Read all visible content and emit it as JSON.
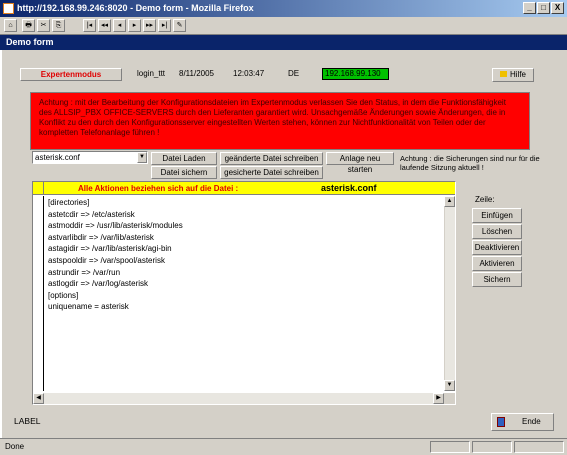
{
  "window": {
    "title": "http://192.168.99.246:8020 - Demo form - Mozilla Firefox",
    "minimize": "_",
    "maximize": "□",
    "close": "X"
  },
  "toolbar": {
    "buttons": [
      "⌂",
      "🖶",
      "✂",
      "⎘",
      "|◂",
      "◂◂",
      "◂",
      "▸",
      "▸▸",
      "▸|",
      "✎"
    ]
  },
  "form": {
    "title": "Demo form"
  },
  "header": {
    "mode_label": "Expertenmodus",
    "user": "login_ttt",
    "date": "8/11/2005",
    "time": "12:03:47",
    "lang": "DE",
    "ip": "192.168.99.130",
    "help_label": "Hilfe"
  },
  "warning": "Achtung : mit der Bearbeitung der Konfigurationsdateien im Expertenmodus verlassen Sie den Status, in dem die Funktionsfähigkeit des ALLSIP_PBX OFFICE-SERVERS durch den Lieferanten garantiert wird. Unsachgemäße Änderungen sowie Änderungen, die in Konflikt zu den durch den Konfigurationsserver eingestellten Werten stehen, können zur Nichtfunktionalität von Teilen oder der kompletten Telefonanlage führen !",
  "file_select": {
    "value": "asterisk.conf",
    "arrow": "▼"
  },
  "actions": {
    "load": "Datei Laden",
    "save": "Datei sichern",
    "write_changed": "geänderte Datei schreiben",
    "write_saved": "gesicherte Datei schreiben",
    "restart": "Anlage neu starten"
  },
  "note": "Achtung : die Sicherungen sind nur für die laufende Sitzung aktuell !",
  "editor": {
    "header_label": "Alle Aktionen beziehen sich auf die Datei :",
    "header_file": "asterisk.conf",
    "lines": [
      "[directories]",
      "astetcdir => /etc/asterisk",
      "astmoddir => /usr/lib/asterisk/modules",
      "astvarlibdir => /var/lib/asterisk",
      "astagidir => /var/lib/asterisk/agi-bin",
      "astspooldir => /var/spool/asterisk",
      "astrundir => /var/run",
      "astlogdir => /var/log/asterisk",
      "[options]",
      "uniquename = asterisk"
    ]
  },
  "row_panel": {
    "title": "Zeile:",
    "buttons": [
      "Einfügen",
      "Löschen",
      "Deaktivieren",
      "Aktivieren",
      "Sichern"
    ]
  },
  "footer": {
    "label": "LABEL",
    "end_label": "Ende"
  },
  "status": {
    "text": "Done"
  }
}
